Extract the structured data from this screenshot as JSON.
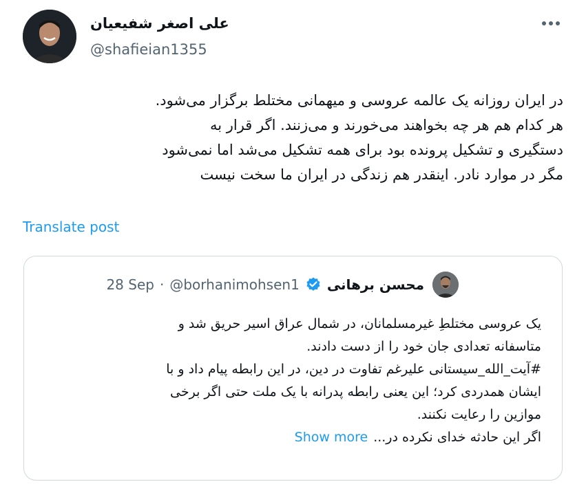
{
  "tweet": {
    "author_name": "علی اصغر شفیعیان",
    "author_handle": "@shafieian1355",
    "more_icon": "more-horizontal-icon",
    "text_lines": [
      "در ایران روزانه یک عالمه عروسی و میهمانی مختلط برگزار می‌شود.",
      "هر کدام هم هر چه بخواهند می‌خورند و می‌زنند. اگر قرار به",
      "دستگیری و تشکیل پرونده بود برای همه تشکیل می‌شد اما نمی‌شود",
      "مگر در موارد نادر. اینقدر هم زندگی در ایران ما سخت نیست"
    ],
    "translate_label": "Translate post"
  },
  "quote": {
    "author_name": "محسن برهانی",
    "verified_icon": "verified-badge-icon",
    "handle": "@borhanimohsen1",
    "separator": "·",
    "date": "28 Sep",
    "text_lines": [
      "یک عروسی مختلطِ غیرمسلمانان، در شمال عراق اسیر حریق شد و",
      "متاسفانه تعدادی جان خود را از دست دادند.",
      "#آیت_الله_سیستانی علیرغم تفاوت در دین، در این رابطه پیام داد و با",
      "ایشان همدردی کرد؛ این یعنی رابطه پدرانه با یک ملت حتی اگر برخی",
      "موازین را رعایت نکنند."
    ],
    "last_line": "اگر این حادثه خدای نکرده در...",
    "show_more_label": "Show more"
  },
  "colors": {
    "link_blue": "#1d9bf0",
    "secondary_text": "#536471",
    "border": "#cfd9de"
  }
}
